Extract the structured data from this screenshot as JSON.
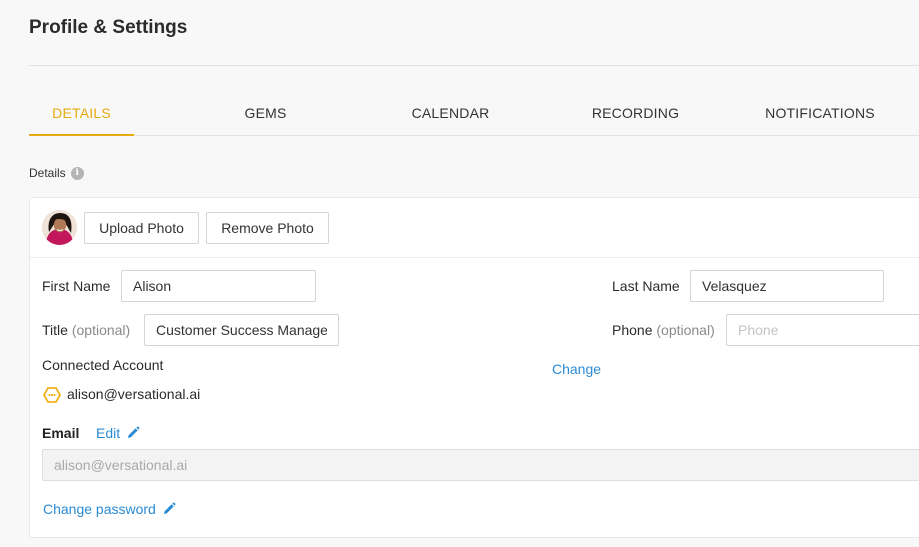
{
  "page": {
    "title": "Profile & Settings"
  },
  "tabs": [
    {
      "label": "DETAILS",
      "active": true
    },
    {
      "label": "GEMS",
      "active": false
    },
    {
      "label": "CALENDAR",
      "active": false
    },
    {
      "label": "RECORDING",
      "active": false
    },
    {
      "label": "NOTIFICATIONS",
      "active": false
    }
  ],
  "details": {
    "section_label": "Details",
    "info_icon": "i",
    "upload_photo": "Upload Photo",
    "remove_photo": "Remove Photo",
    "first_name_label": "First Name",
    "first_name": "Alison",
    "last_name_label": "Last Name",
    "last_name": "Velasquez",
    "title_label": "Title",
    "optional": "(optional)",
    "title_value": "Customer Success Manage",
    "phone_label": "Phone",
    "phone_placeholder": "Phone",
    "phone_value": "",
    "connected_account_label": "Connected Account",
    "change_link": "Change",
    "connected_email": "alison@versational.ai",
    "email_label": "Email",
    "edit_link": "Edit",
    "email_value": "alison@versational.ai",
    "change_password": "Change password"
  },
  "colors": {
    "accent": "#e8aa11",
    "link": "#2a8bd5",
    "background": "#f8f8f8"
  },
  "icons": {
    "info": "info-icon",
    "account": "connected-account-icon",
    "pencil": "pencil-icon"
  }
}
